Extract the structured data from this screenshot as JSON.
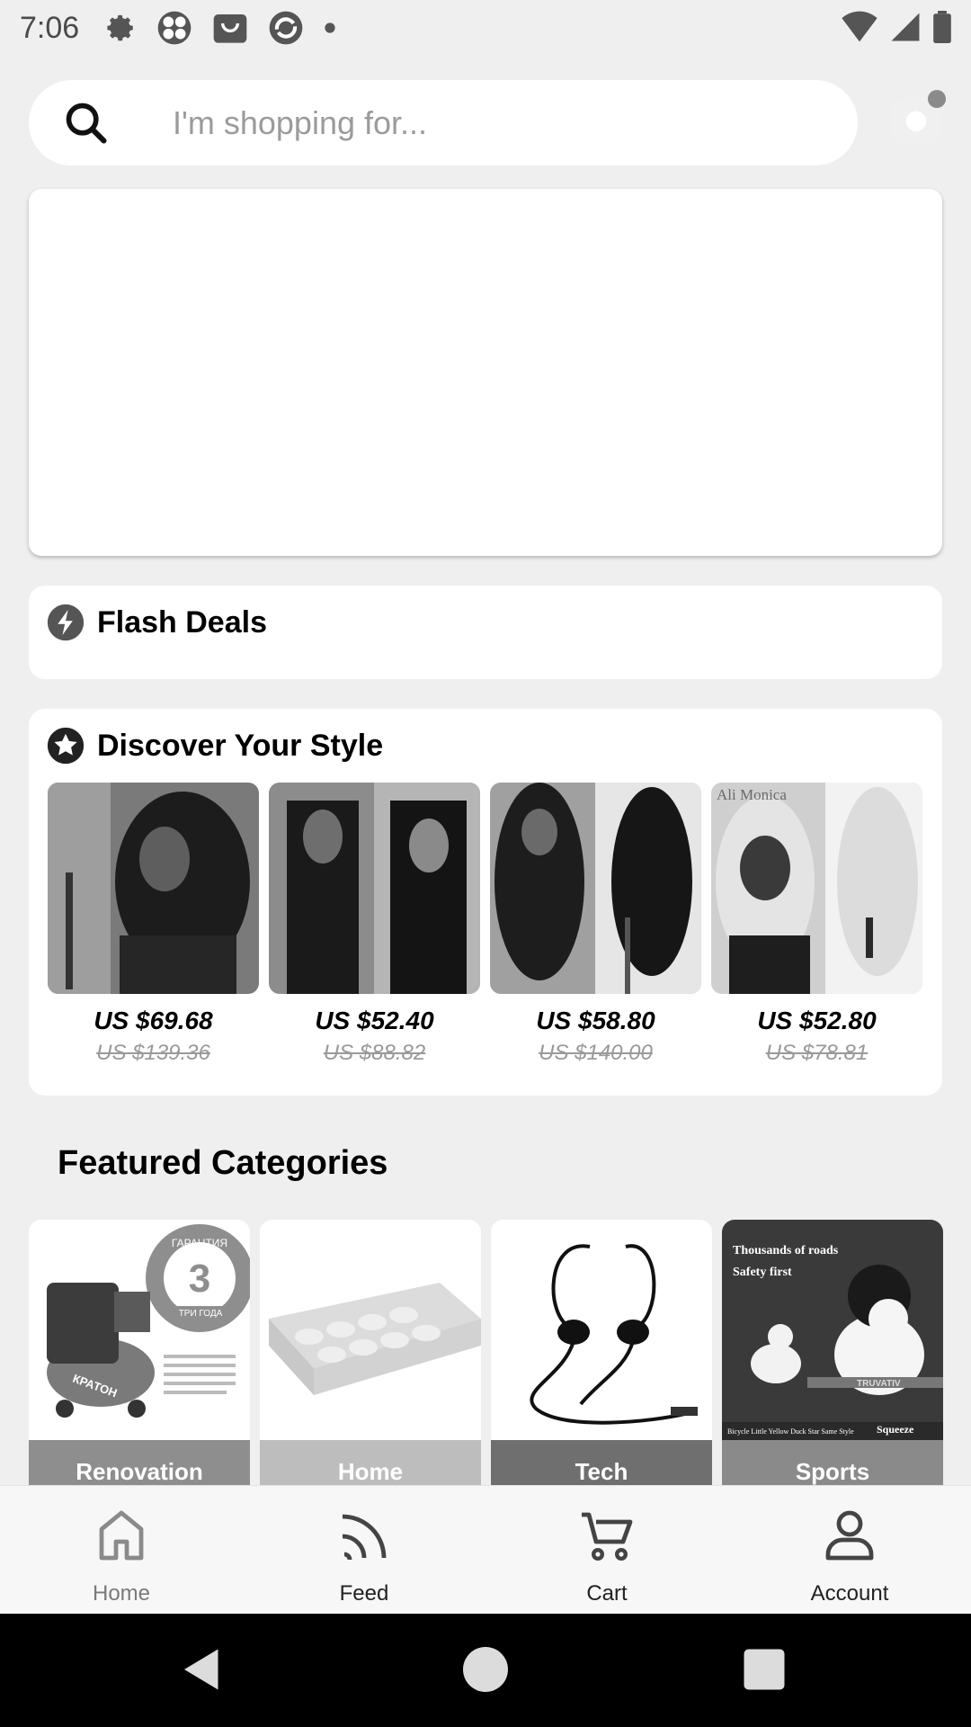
{
  "status_bar": {
    "time": "7:06",
    "icons": [
      "gear-icon",
      "fan-icon",
      "shop-icon",
      "sync-icon",
      "dot-icon"
    ],
    "right_icons": [
      "wifi-icon",
      "signal-icon",
      "battery-icon"
    ]
  },
  "search": {
    "placeholder": "I'm shopping for..."
  },
  "flash_deals": {
    "title": "Flash Deals"
  },
  "discover": {
    "title": "Discover Your Style",
    "products": [
      {
        "price": "US $69.68",
        "original_price": "US $139.36"
      },
      {
        "price": "US $52.40",
        "original_price": "US $88.82"
      },
      {
        "price": "US $58.80",
        "original_price": "US $140.00"
      },
      {
        "price": "US $52.80",
        "original_price": "US $78.81",
        "image_text": "Ali Monica"
      }
    ]
  },
  "featured": {
    "title": "Featured Categories",
    "categories": [
      {
        "label": "Renovation",
        "image_text": [
          "ГАРАНТИЯ",
          "3",
          "ТРИ ГОДА",
          "КРАТОН"
        ]
      },
      {
        "label": "Home"
      },
      {
        "label": "Tech"
      },
      {
        "label": "Sports",
        "image_text": [
          "Thousands of roads",
          "Safety first",
          "Squeeze",
          "TRUVATIV",
          "Bicycle Little Yellow Duck Star Same Style"
        ]
      }
    ]
  },
  "bottom_nav": {
    "items": [
      {
        "label": "Home",
        "icon": "home-icon"
      },
      {
        "label": "Feed",
        "icon": "feed-icon"
      },
      {
        "label": "Cart",
        "icon": "cart-icon"
      },
      {
        "label": "Account",
        "icon": "account-icon"
      }
    ]
  },
  "colors": {
    "background": "#efefef",
    "card": "#ffffff",
    "muted_text": "#9b9b9b"
  }
}
